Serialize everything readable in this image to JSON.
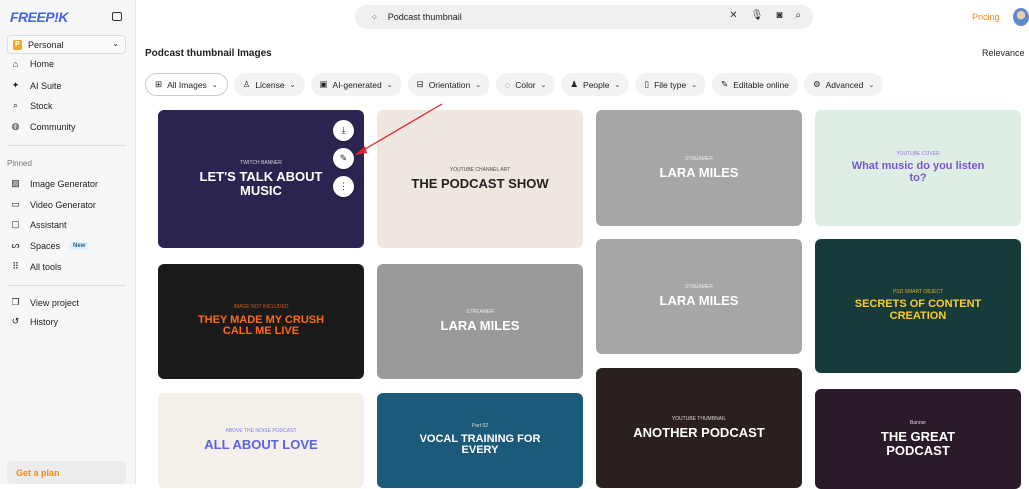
{
  "sidebar": {
    "logo": "FREEP!K",
    "workspace": "Personal",
    "nav": [
      {
        "label": "Home",
        "icon": "home-icon"
      },
      {
        "label": "AI Suite",
        "icon": "sparkle-icon"
      },
      {
        "label": "Stock",
        "icon": "search-icon"
      },
      {
        "label": "Community",
        "icon": "globe-icon"
      }
    ],
    "pinned_label": "Pinned",
    "pinned": [
      {
        "label": "Image Generator",
        "icon": "image-icon"
      },
      {
        "label": "Video Generator",
        "icon": "video-icon"
      },
      {
        "label": "Assistant",
        "icon": "chat-icon"
      },
      {
        "label": "Spaces",
        "icon": "spaces-icon",
        "badge": "New"
      },
      {
        "label": "All tools",
        "icon": "grid-icon"
      }
    ],
    "bottom": [
      {
        "label": "View project",
        "icon": "project-icon"
      },
      {
        "label": "History",
        "icon": "history-icon"
      }
    ],
    "plan": "Get a plan"
  },
  "header": {
    "search_value": "Podcast thumbnail",
    "pricing": "Pricing"
  },
  "main": {
    "title": "Podcast thumbnail Images",
    "sort": "Relevance",
    "filters": [
      {
        "label": "All Images",
        "icon": "⊞",
        "chev": true
      },
      {
        "label": "License",
        "icon": "♙",
        "chev": true
      },
      {
        "label": "AI-generated",
        "icon": "▣",
        "chev": true
      },
      {
        "label": "Orientation",
        "icon": "⊟",
        "chev": true
      },
      {
        "label": "Color",
        "icon": "◌",
        "chev": true
      },
      {
        "label": "People",
        "icon": "♟",
        "chev": true
      },
      {
        "label": "File type",
        "icon": "▯",
        "chev": true
      },
      {
        "label": "Editable online",
        "icon": "✎",
        "chev": false
      },
      {
        "label": "Advanced",
        "icon": "⚙",
        "chev": true
      }
    ],
    "cards": [
      {
        "small": "TWITCH BANNER",
        "text": "LET'S TALK ABOUT MUSIC",
        "bg": "#2a2450",
        "fg": "#fff"
      },
      {
        "small": "IMAGE NOT INCLUDED",
        "text": "THEY MADE MY CRUSH CALL ME LIVE",
        "bg": "#1a1a1a",
        "fg": "#ff6a1a"
      },
      {
        "small": "ABOVE THE NOISE PODCAST",
        "text": "ALL ABOUT LOVE",
        "bg": "#f5f0ea",
        "fg": "#5a62e8"
      },
      {
        "small": "YOUTUBE CHANNEL ART",
        "text": "THE PODCAST SHOW",
        "bg": "#efe6df",
        "fg": "#222"
      },
      {
        "small": "STREAMER",
        "text": "LARA MILES",
        "bg": "#9a9a9a",
        "fg": "#fff"
      },
      {
        "small": "Part 02",
        "text": "VOCAL TRAINING FOR EVERY",
        "bg": "#1c5a7a",
        "fg": "#fff"
      },
      {
        "small": "STREAMER",
        "text": "LARA MILES",
        "bg": "#a6a6a6",
        "fg": "#fff"
      },
      {
        "small": "STREAMER",
        "text": "LARA MILES",
        "bg": "#a6a6a6",
        "fg": "#fff"
      },
      {
        "small": "YOUTUBE THUMBNAIL",
        "text": "ANOTHER PODCAST",
        "bg": "#2a2020",
        "fg": "#fff"
      },
      {
        "small": "YOUTUBE COVER",
        "text": "What music do you listen to?",
        "bg": "#dfeee4",
        "fg": "#7a55d0"
      },
      {
        "small": "PSD SMART OBJECT",
        "text": "SECRETS OF CONTENT CREATION",
        "bg": "#173a3a",
        "fg": "#ffcc22"
      },
      {
        "small": "Banner",
        "text": "THE GREAT PODCAST",
        "bg": "#2a1a2a",
        "fg": "#fff"
      }
    ]
  }
}
